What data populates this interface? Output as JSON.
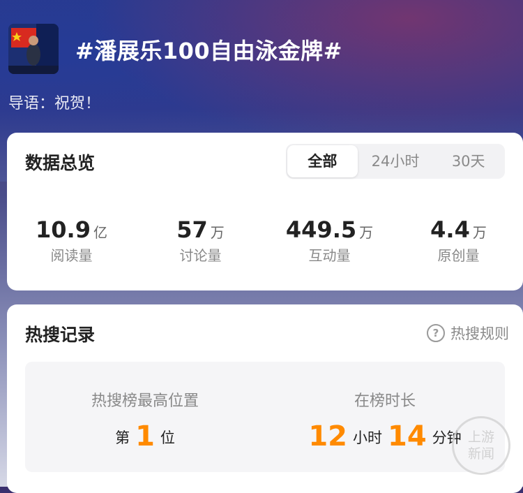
{
  "topic": {
    "title": "#潘展乐100自由泳金牌#",
    "lead": "导语：祝贺！"
  },
  "overview": {
    "title": "数据总览",
    "tabs": [
      "全部",
      "24小时",
      "30天"
    ],
    "active_tab": "全部",
    "stats": [
      {
        "value": "10.9",
        "unit": "亿",
        "label": "阅读量"
      },
      {
        "value": "57",
        "unit": "万",
        "label": "讨论量"
      },
      {
        "value": "449.5",
        "unit": "万",
        "label": "互动量"
      },
      {
        "value": "4.4",
        "unit": "万",
        "label": "原创量"
      }
    ]
  },
  "hot_search": {
    "title": "热搜记录",
    "rules_label": "热搜规则",
    "peak_label": "热搜榜最高位置",
    "peak_prefix": "第",
    "peak_value": "1",
    "peak_suffix": "位",
    "duration_label": "在榜时长",
    "hours_value": "12",
    "hours_unit": "小时",
    "minutes_value": "14",
    "minutes_unit": "分钟"
  },
  "watermark": "上游新闻",
  "colors": {
    "accent_orange": "#ff8a00",
    "card_bg": "#ffffff"
  },
  "icons": [
    "topic-thumbnail",
    "question-circle-icon"
  ]
}
